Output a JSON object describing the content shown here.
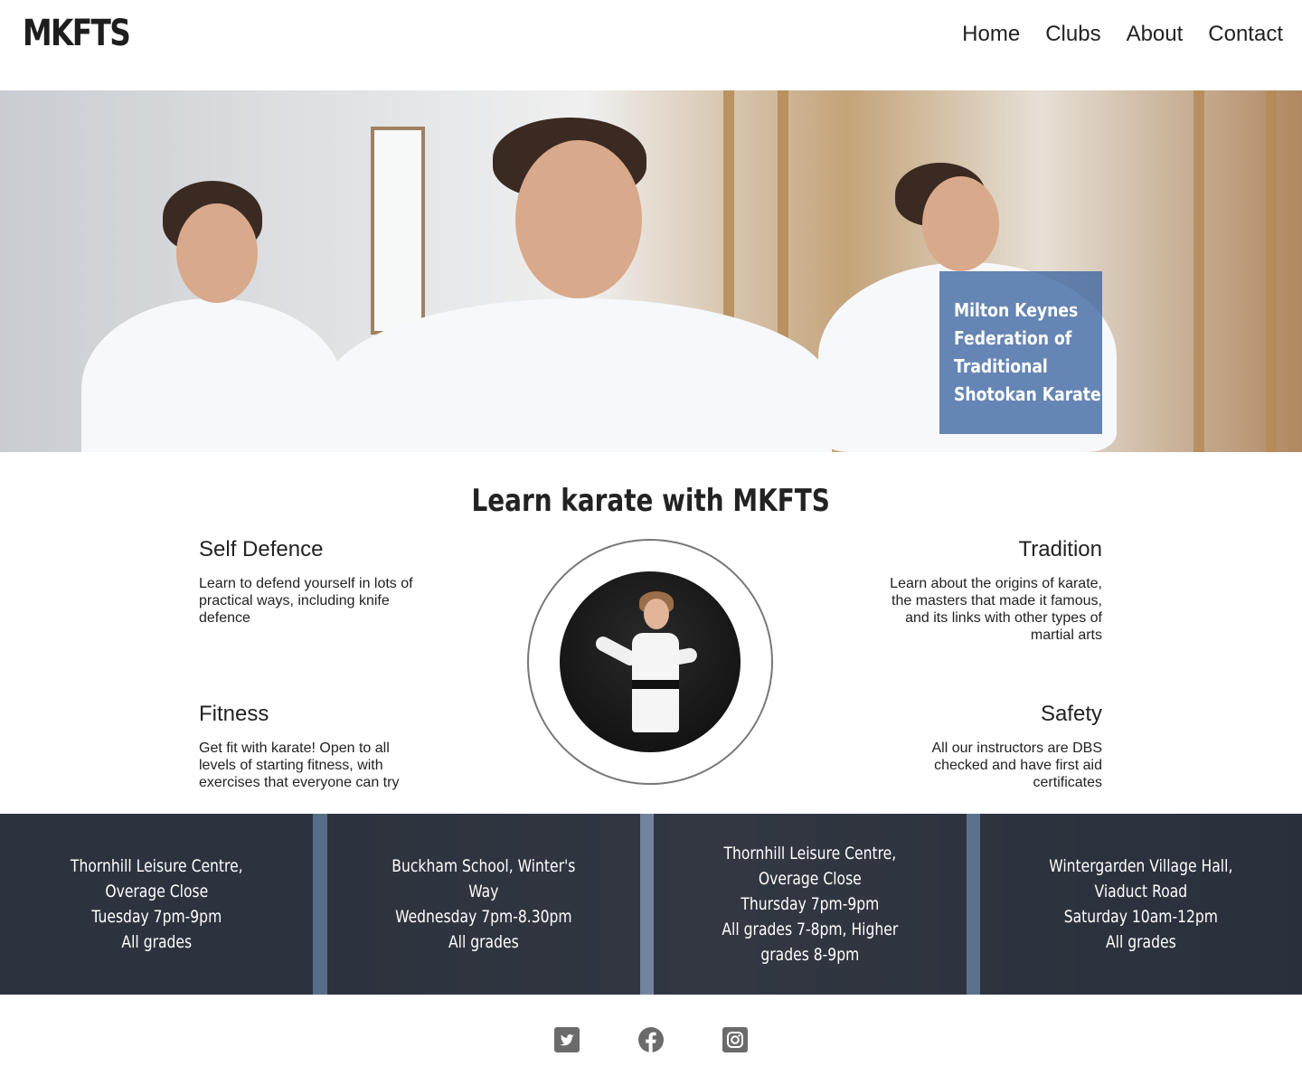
{
  "header": {
    "logo": "MKFTS",
    "nav": [
      "Home",
      "Clubs",
      "About",
      "Contact"
    ]
  },
  "hero": {
    "caption": [
      "Milton Keynes",
      "Federation of",
      "Traditional",
      "Shotokan Karate"
    ]
  },
  "intro": {
    "title": "Learn karate with MKFTS",
    "features": [
      {
        "title": "Self Defence",
        "text": "Learn to defend yourself in lots of practical ways, including knife defence"
      },
      {
        "title": "Tradition",
        "text": "Learn about the origins of karate, the masters that made it famous, and its links with other types of martial arts"
      },
      {
        "title": "Fitness",
        "text": "Get fit with karate! Open to all levels of starting fitness, with exercises that everyone can try"
      },
      {
        "title": "Safety",
        "text": "All our instructors are DBS checked and have first aid certificates"
      }
    ]
  },
  "locations": [
    {
      "lines": [
        "Thornhill Leisure Centre,",
        "Overage Close",
        "Tuesday 7pm-9pm",
        "All grades"
      ]
    },
    {
      "lines": [
        "Buckham School, Winter's",
        "Way",
        "Wednesday 7pm-8.30pm",
        "All grades"
      ]
    },
    {
      "lines": [
        "Thornhill Leisure Centre,",
        "Overage Close",
        "Thursday 7pm-9pm",
        "All grades 7-8pm, Higher",
        "grades 8-9pm"
      ]
    },
    {
      "lines": [
        "Wintergarden Village Hall,",
        "Viaduct Road",
        "Saturday 10am-12pm",
        "All grades"
      ]
    }
  ],
  "footer": {
    "social": [
      "twitter-icon",
      "facebook-icon",
      "instagram-icon"
    ],
    "icon_color": "#6b6b6b"
  },
  "colors": {
    "caption_bg": "#3c64a0",
    "band_card": "#262a32",
    "text": "#222222"
  }
}
